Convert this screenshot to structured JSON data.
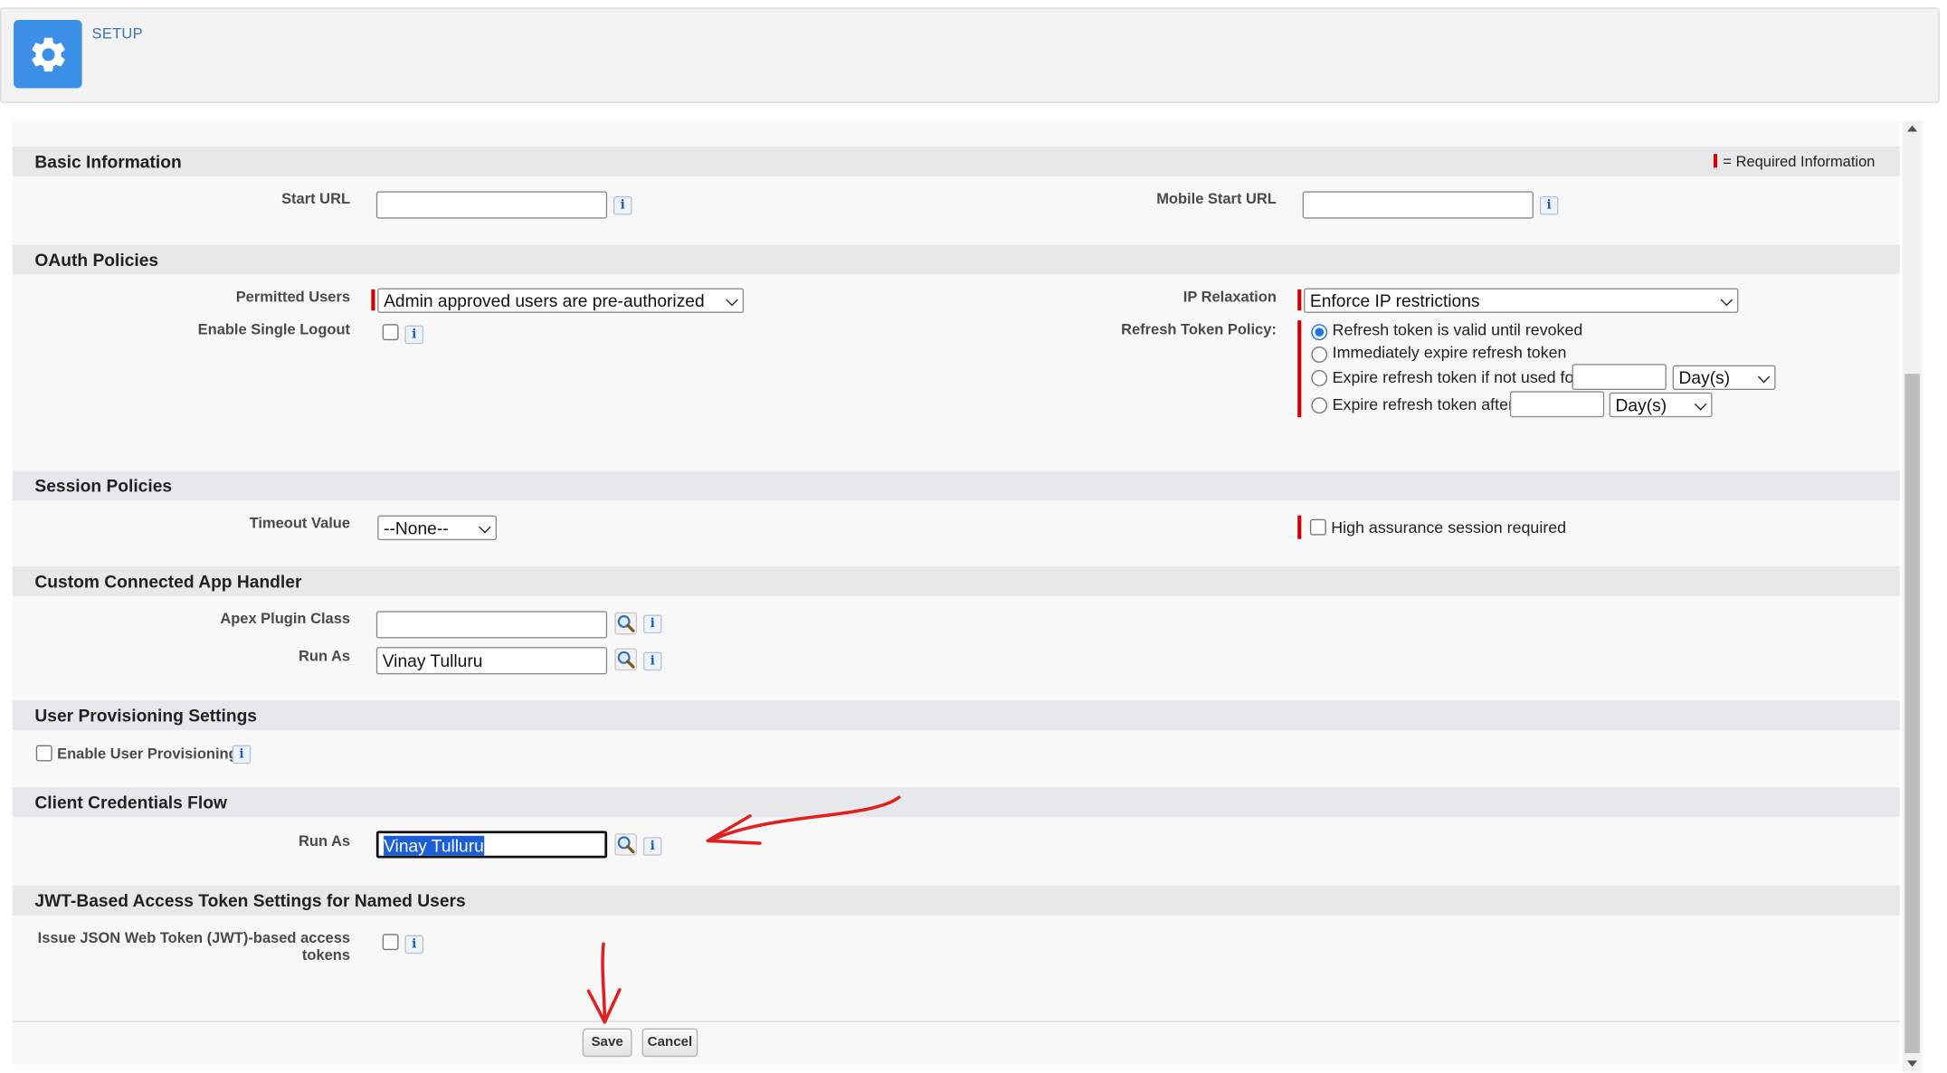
{
  "header": {
    "title": "SETUP"
  },
  "legend": {
    "required": "= Required Information"
  },
  "sections": {
    "basic": "Basic Information",
    "oauth": "OAuth Policies",
    "session": "Session Policies",
    "handler": "Custom Connected App Handler",
    "provisioning": "User Provisioning Settings",
    "client_credentials": "Client Credentials Flow",
    "jwt": "JWT-Based Access Token Settings for Named Users"
  },
  "basic": {
    "start_url_label": "Start URL",
    "start_url_value": "",
    "mobile_start_url_label": "Mobile Start URL",
    "mobile_start_url_value": ""
  },
  "oauth": {
    "permitted_users_label": "Permitted Users",
    "permitted_users_value": "Admin approved users are pre-authorized",
    "single_logout_label": "Enable Single Logout",
    "single_logout_checked": false,
    "ip_relaxation_label": "IP Relaxation",
    "ip_relaxation_value": "Enforce IP restrictions",
    "refresh_policy_label": "Refresh Token Policy:",
    "refresh_options": [
      "Refresh token is valid until revoked",
      "Immediately expire refresh token",
      "Expire refresh token if not used for",
      "Expire refresh token after"
    ],
    "refresh_selected_index": 0,
    "unit_value": "Day(s)"
  },
  "session": {
    "timeout_label": "Timeout Value",
    "timeout_value": "--None--",
    "high_assurance_label": "High assurance session required"
  },
  "handler": {
    "apex_label": "Apex Plugin Class",
    "apex_value": "",
    "run_as_label": "Run As",
    "run_as_value": "Vinay Tulluru"
  },
  "provisioning": {
    "enable_label": "Enable User Provisioning"
  },
  "client_credentials": {
    "run_as_label": "Run As",
    "run_as_value": "Vinay Tulluru"
  },
  "jwt": {
    "issue_label_line1": "Issue JSON Web Token (JWT)-based access",
    "issue_label_line2": "tokens"
  },
  "buttons": {
    "save": "Save",
    "cancel": "Cancel"
  },
  "info_glyph": "i",
  "colors": {
    "accent": "#3b8fe6",
    "required": "#cc0000",
    "annotation": "#e02020",
    "selection": "#1a5fd6"
  }
}
